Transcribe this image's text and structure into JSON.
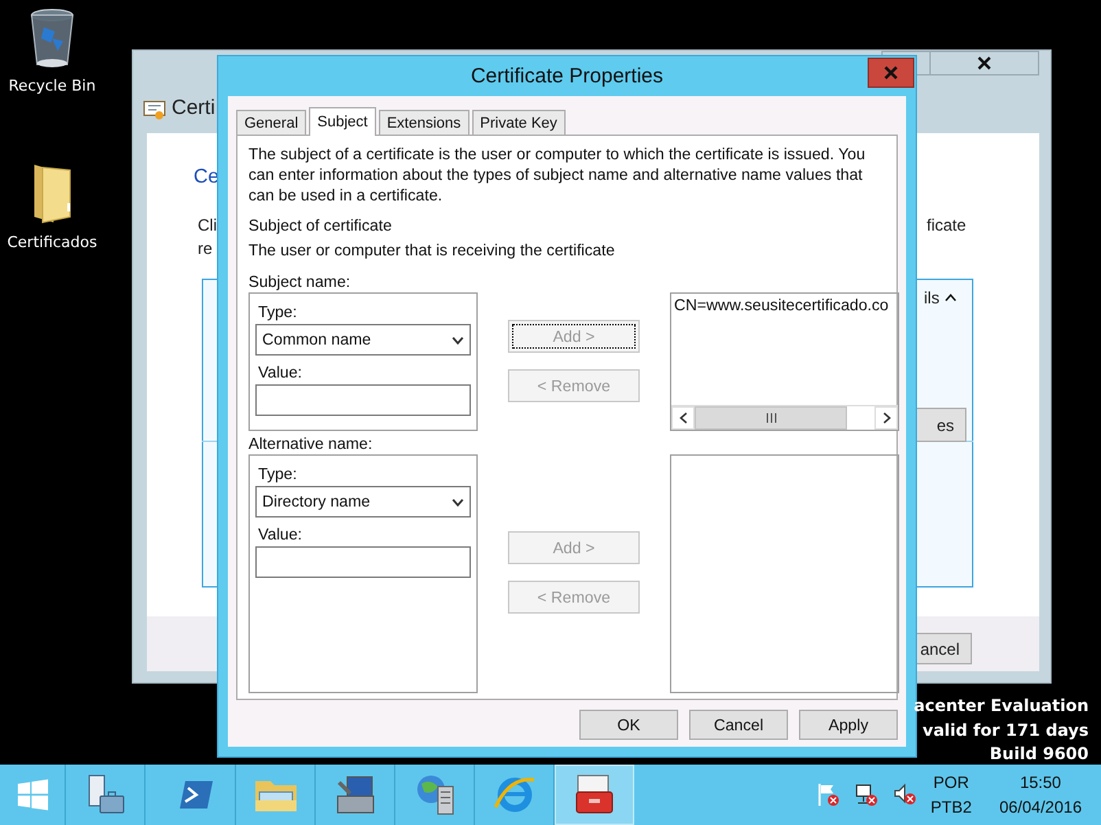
{
  "desktop_icons": [
    {
      "kind": "bin",
      "label": "Recycle Bin"
    },
    {
      "kind": "folder",
      "label": "Certificados"
    }
  ],
  "background_window": {
    "title": "Certi",
    "heading": "Ce",
    "text_lines": [
      "Cli",
      "re"
    ],
    "text_right": "ficate",
    "details_label": "ils",
    "side_button": "es",
    "cancel_button": "ancel"
  },
  "dialog": {
    "title": "Certificate Properties",
    "tabs": [
      {
        "label": "General",
        "selected": false
      },
      {
        "label": "Subject",
        "selected": true
      },
      {
        "label": "Extensions",
        "selected": false
      },
      {
        "label": "Private Key",
        "selected": false
      }
    ],
    "description": "The subject of a certificate is the user or computer to which the certificate is issued. You can enter information about the types of subject name and alternative name values that can be used in a certificate.",
    "section_title": "Subject of certificate",
    "section_subtitle": "The user or computer that is receiving the certificate",
    "groups": [
      {
        "label": "Subject name:",
        "type_label": "Type:",
        "type_value": "Common name",
        "value_label": "Value:",
        "add_button": {
          "label": "Add >",
          "disabled": true,
          "focused": true
        },
        "remove_button": {
          "label": "< Remove",
          "disabled": true,
          "focused": false
        },
        "entries": [
          "CN=www.seusitecertificado.co"
        ],
        "scrollbar": true
      },
      {
        "label": "Alternative name:",
        "type_label": "Type:",
        "type_value": "Directory name",
        "value_label": "Value:",
        "add_button": {
          "label": "Add >",
          "disabled": true,
          "focused": false
        },
        "remove_button": {
          "label": "< Remove",
          "disabled": true,
          "focused": false
        },
        "scrollbar": false
      }
    ],
    "buttons": [
      "OK",
      "Cancel",
      "Apply"
    ]
  },
  "edition_notice": [
    "acenter Evaluation",
    "valid for 171 days",
    "Build 9600"
  ],
  "taskbar": {
    "apps": [
      {
        "kind": "server-manager",
        "selected": false
      },
      {
        "kind": "powershell",
        "selected": false
      },
      {
        "kind": "explorer",
        "selected": false
      },
      {
        "kind": "computer-tools",
        "selected": false
      },
      {
        "kind": "globe-server",
        "selected": false
      },
      {
        "kind": "browser",
        "selected": false
      },
      {
        "kind": "toolbox",
        "selected": true
      }
    ],
    "language": [
      "POR",
      "PTB2"
    ],
    "time": "15:50",
    "date": "06/04/2016"
  }
}
